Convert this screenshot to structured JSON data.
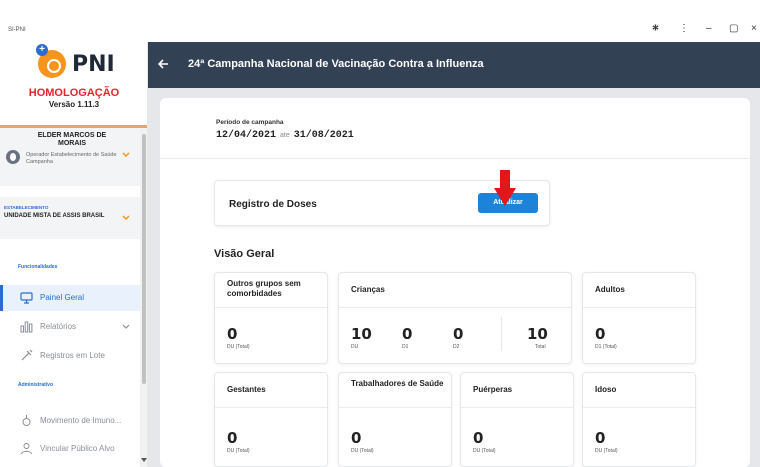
{
  "app": {
    "name": "SI-PNI",
    "window_controls": [
      "🞷",
      "⋮",
      "–",
      "▢",
      "×"
    ]
  },
  "sidebar": {
    "logo_text": "PNI",
    "environment": "HOMOLOGAÇÃO",
    "version": "Versão 1.11.3",
    "user": {
      "name": "ELDER MARCOS DE MORAIS",
      "role": "Operador Estabelecimento de Saúde Campanha"
    },
    "establishment": {
      "label": "ESTABELECIMENTO",
      "value": "UNIDADE MISTA DE ASSIS BRASIL"
    },
    "sections": {
      "functionalities": "Funcionalidades",
      "administrative": "Administrativo"
    },
    "items": [
      {
        "label": "Painel Geral",
        "icon": "monitor-icon",
        "active": true
      },
      {
        "label": "Relatórios",
        "icon": "chart-icon",
        "active": false
      },
      {
        "label": "Registros em Lote",
        "icon": "syringe-icon",
        "active": false
      },
      {
        "label": "Movimento de Imuno...",
        "icon": "vial-icon",
        "active": false
      },
      {
        "label": "Vincular Público Alvo",
        "icon": "people-icon",
        "active": false
      }
    ]
  },
  "header": {
    "title": "24ª Campanha Nacional de Vacinação Contra a Influenza",
    "back_icon": "arrow-left-icon"
  },
  "campaign": {
    "period_label": "Período de campanha",
    "start": "12/04/2021",
    "separator": "ate",
    "end": "31/08/2021"
  },
  "doses": {
    "title": "Registro de Doses",
    "button": "Atualizar"
  },
  "overview": {
    "title": "Visão Geral",
    "cards": [
      {
        "title": "Outros grupos sem comorbidades",
        "metrics": [
          {
            "value": "0",
            "label": "DU (Total)"
          }
        ]
      },
      {
        "title": "Crianças",
        "metrics": [
          {
            "value": "10",
            "label": "DU"
          },
          {
            "value": "0",
            "label": "D1"
          },
          {
            "value": "0",
            "label": "D2"
          },
          {
            "value": "10",
            "label": "Total"
          }
        ]
      },
      {
        "title": "Adultos",
        "metrics": [
          {
            "value": "0",
            "label": "D1 (Total)"
          }
        ]
      },
      {
        "title": "Gestantes",
        "metrics": [
          {
            "value": "0",
            "label": "DU (Total)"
          }
        ]
      },
      {
        "title": "Trabalhadores de Saúde",
        "metrics": [
          {
            "value": "0",
            "label": "DU (Total)"
          }
        ]
      },
      {
        "title": "Puérperas",
        "metrics": [
          {
            "value": "0",
            "label": "DU (Total)"
          }
        ]
      },
      {
        "title": "Idoso",
        "metrics": [
          {
            "value": "0",
            "label": "DU (Total)"
          }
        ]
      }
    ]
  },
  "colors": {
    "header": "#334155",
    "accent": "#2b6dcf",
    "button": "#1d83d9",
    "environment": "#e3242b",
    "logo": "#f7941d"
  }
}
